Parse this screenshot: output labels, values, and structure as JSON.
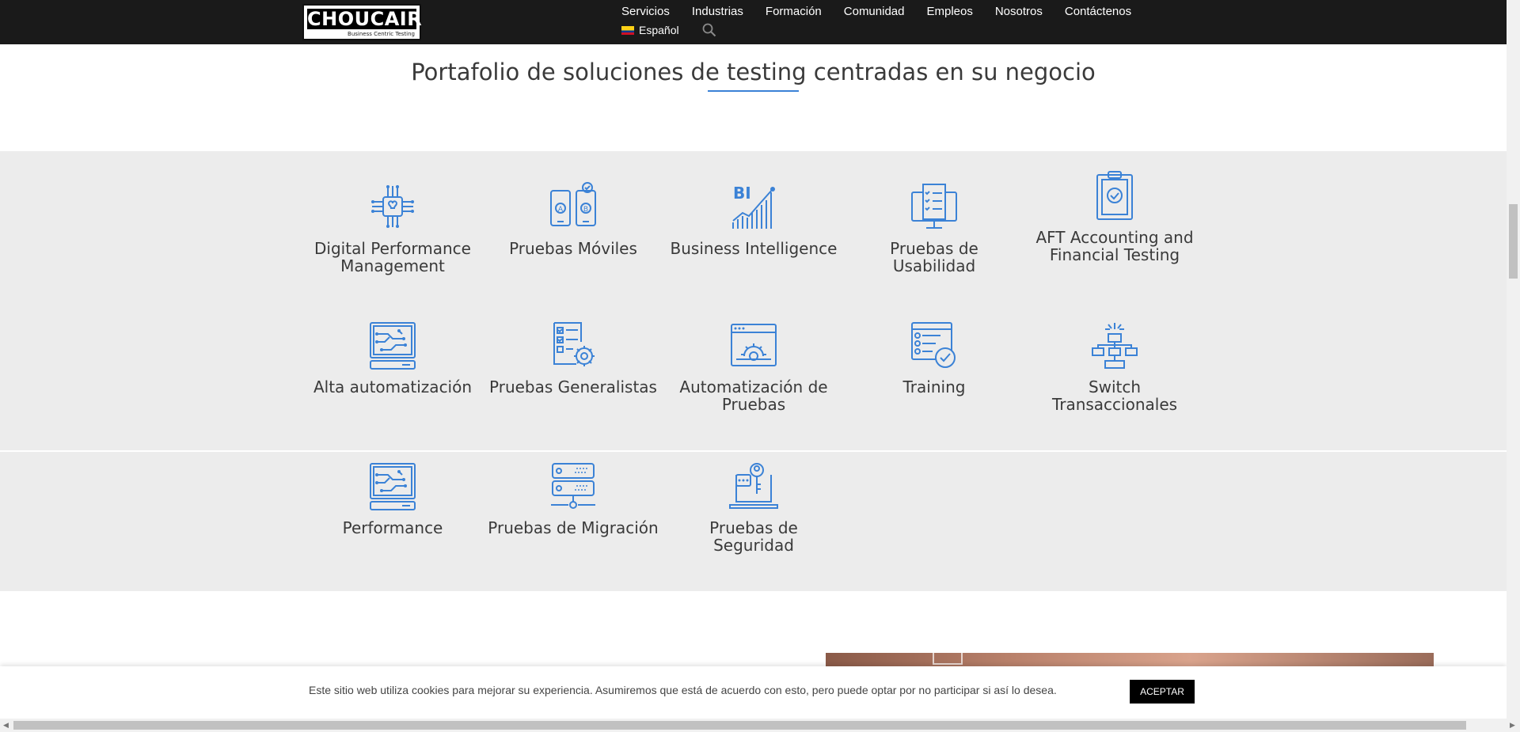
{
  "header": {
    "logo_text": "CHOUCAIR",
    "logo_tagline": "Business Centric Testing",
    "nav": [
      "Servicios",
      "Industrias",
      "Formación",
      "Comunidad",
      "Empleos",
      "Nosotros",
      "Contáctenos"
    ],
    "language": "Español"
  },
  "section": {
    "title": "Portafolio de soluciones de testing centradas en su negocio"
  },
  "tiles": {
    "row1": [
      {
        "label_1": "Digital Performance",
        "label_2": "Management",
        "icon": "chip-brain-icon"
      },
      {
        "label_1": "Pruebas Móviles",
        "label_2": "",
        "icon": "mobile-ab-icon"
      },
      {
        "label_1": "Business Intelligence",
        "label_2": "",
        "icon": "bi-chart-icon"
      },
      {
        "label_1": "Pruebas de",
        "label_2": "Usabilidad",
        "icon": "usability-monitor-icon"
      },
      {
        "label_1": "AFT Accounting and",
        "label_2": "Financial Testing",
        "icon": "clipboard-check-icon"
      }
    ],
    "row2": [
      {
        "label_1": "Alta automatización",
        "label_2": "",
        "icon": "circuit-monitor-icon"
      },
      {
        "label_1": "Pruebas Generalistas",
        "label_2": "",
        "icon": "checklist-gear-icon"
      },
      {
        "label_1": "Automatización de",
        "label_2": "Pruebas",
        "icon": "browser-gear-icon"
      },
      {
        "label_1": "Training",
        "label_2": "",
        "icon": "checklist-check-icon"
      },
      {
        "label_1": "Switch",
        "label_2": "Transaccionales",
        "icon": "network-switch-icon"
      }
    ],
    "row3": [
      {
        "label_1": "Performance",
        "label_2": "",
        "icon": "circuit-monitor-icon"
      },
      {
        "label_1": "Pruebas de Migración",
        "label_2": "",
        "icon": "server-migration-icon"
      },
      {
        "label_1": "Pruebas de",
        "label_2": "Seguridad",
        "icon": "laptop-key-icon"
      }
    ]
  },
  "cookie": {
    "text": "Este sitio web utiliza cookies para mejorar su experiencia. Asumiremos que está de acuerdo con esto, pero puede optar por no participar si así lo desea.",
    "button": "ACEPTAR"
  },
  "colors": {
    "accent": "#3b82d6",
    "header_bg": "#1a1a1a",
    "band_bg": "#ececec"
  }
}
